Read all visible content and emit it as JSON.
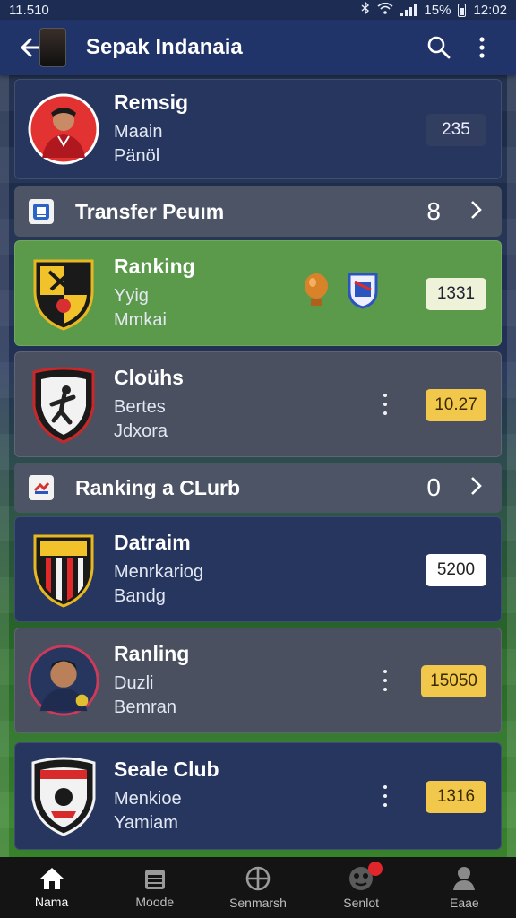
{
  "status_bar": {
    "time": "11.510",
    "battery": "15%",
    "clock": "12:02"
  },
  "app_bar": {
    "title": "Sepak Indanaia"
  },
  "cards": [
    {
      "title": "Remsig",
      "line1": "Maain",
      "line2": "Pänöl",
      "badge": "235"
    },
    {
      "title": "Ranking",
      "line1": "Yyig",
      "line2": "Mmkai",
      "badge": "1331"
    },
    {
      "title": "Cloühs",
      "line1": "Bertes",
      "line2": "Jdxora",
      "badge": "10.27"
    },
    {
      "title": "Datraim",
      "line1": "Menrkariog",
      "line2": "Bandg",
      "badge": "5200"
    },
    {
      "title": "Ranling",
      "line1": "Duzli",
      "line2": "Bemran",
      "badge": "15050"
    },
    {
      "title": "Seale Club",
      "line1": "Menkioe",
      "line2": "Yamiam",
      "badge": "1316"
    }
  ],
  "sections": [
    {
      "title": "Transfer Peuım",
      "count": "8"
    },
    {
      "title": "Ranking a CLurb",
      "count": "0"
    }
  ],
  "bottom_nav": [
    {
      "label": "Nama"
    },
    {
      "label": "Moode"
    },
    {
      "label": "Senmarsh"
    },
    {
      "label": "Senlot"
    },
    {
      "label": "Eaae"
    }
  ],
  "colors": {
    "app_bar": "#21346a",
    "card_navy": "#26365f",
    "card_green": "#5c9a4b",
    "card_gray": "#4a5060",
    "badge_yellow": "#f1c84b",
    "notification": "#e0262b"
  },
  "icons": {
    "status": [
      "bluetooth-icon",
      "wifi-icon",
      "signal-icon",
      "battery-icon"
    ],
    "app_bar": [
      "back-arrow-icon",
      "search-icon",
      "more-vert-icon"
    ],
    "bottom_nav": [
      "home-icon",
      "calendar-icon",
      "target-icon",
      "ball-icon",
      "person-icon"
    ]
  }
}
